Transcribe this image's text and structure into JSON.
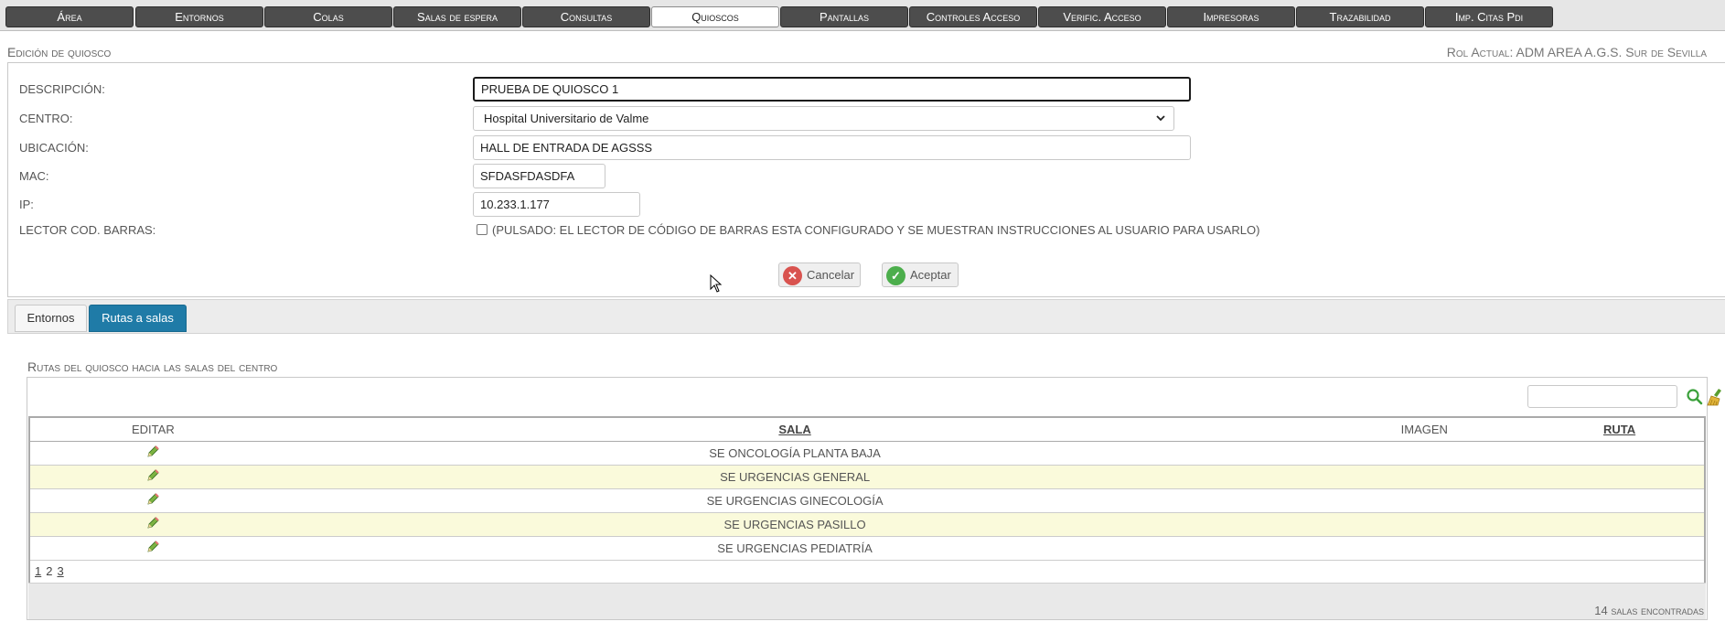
{
  "nav": {
    "tabs": [
      {
        "label": "Área",
        "active": false
      },
      {
        "label": "Entornos",
        "active": false
      },
      {
        "label": "Colas",
        "active": false
      },
      {
        "label": "Salas de espera",
        "active": false
      },
      {
        "label": "Consultas",
        "active": false
      },
      {
        "label": "Quioscos",
        "active": true
      },
      {
        "label": "Pantallas",
        "active": false
      },
      {
        "label": "Controles Acceso",
        "active": false
      },
      {
        "label": "Verific. Acceso",
        "active": false
      },
      {
        "label": "Impresoras",
        "active": false
      },
      {
        "label": "Trazabilidad",
        "active": false
      },
      {
        "label": "Imp. Citas Pdi",
        "active": false
      }
    ]
  },
  "header": {
    "title": "Edición de quiosco",
    "role": "Rol Actual: ADM AREA A.G.S. Sur de Sevilla"
  },
  "form": {
    "descripcion": {
      "label": "DESCRIPCIÓN:",
      "value": "PRUEBA DE QUIOSCO 1"
    },
    "centro": {
      "label": "CENTRO:",
      "value": "Hospital Universitario de Valme"
    },
    "ubicacion": {
      "label": "UBICACIÓN:",
      "value": "HALL DE ENTRADA DE AGSSS"
    },
    "mac": {
      "label": "MAC:",
      "value": "SFDASFDASDFA"
    },
    "ip": {
      "label": "IP:",
      "value": "10.233.1.177"
    },
    "lector": {
      "label": "LECTOR COD. BARRAS:",
      "checked": false,
      "text": "(PULSADO: EL LECTOR DE CÓDIGO DE BARRAS ESTA CONFIGURADO Y SE MUESTRAN INSTRUCCIONES AL USUARIO PARA USARLO)"
    },
    "cancel_label": "Cancelar",
    "accept_label": "Aceptar"
  },
  "subtabs": [
    {
      "label": "Entornos",
      "active": false
    },
    {
      "label": "Rutas a salas",
      "active": true
    }
  ],
  "routes": {
    "title": "Rutas del quiosco hacia las salas del centro",
    "columns": {
      "editar": "EDITAR",
      "sala": "SALA",
      "imagen": "IMAGEN",
      "ruta": "RUTA"
    },
    "rows": [
      {
        "sala": "SE ONCOLOGÍA PLANTA BAJA",
        "imagen": "",
        "ruta": ""
      },
      {
        "sala": "SE URGENCIAS GENERAL",
        "imagen": "",
        "ruta": ""
      },
      {
        "sala": "SE URGENCIAS GINECOLOGÍA",
        "imagen": "",
        "ruta": ""
      },
      {
        "sala": "SE URGENCIAS PASILLO",
        "imagen": "",
        "ruta": ""
      },
      {
        "sala": "SE URGENCIAS PEDIATRÍA",
        "imagen": "",
        "ruta": ""
      }
    ],
    "pages": [
      "1",
      "2",
      "3"
    ],
    "current_page": "2",
    "count_text": "14 salas encontradas"
  },
  "colors": {
    "nav_bg": "#4d4d4d",
    "active_subtab": "#1f7ba7",
    "row_alt": "#fafadb"
  }
}
